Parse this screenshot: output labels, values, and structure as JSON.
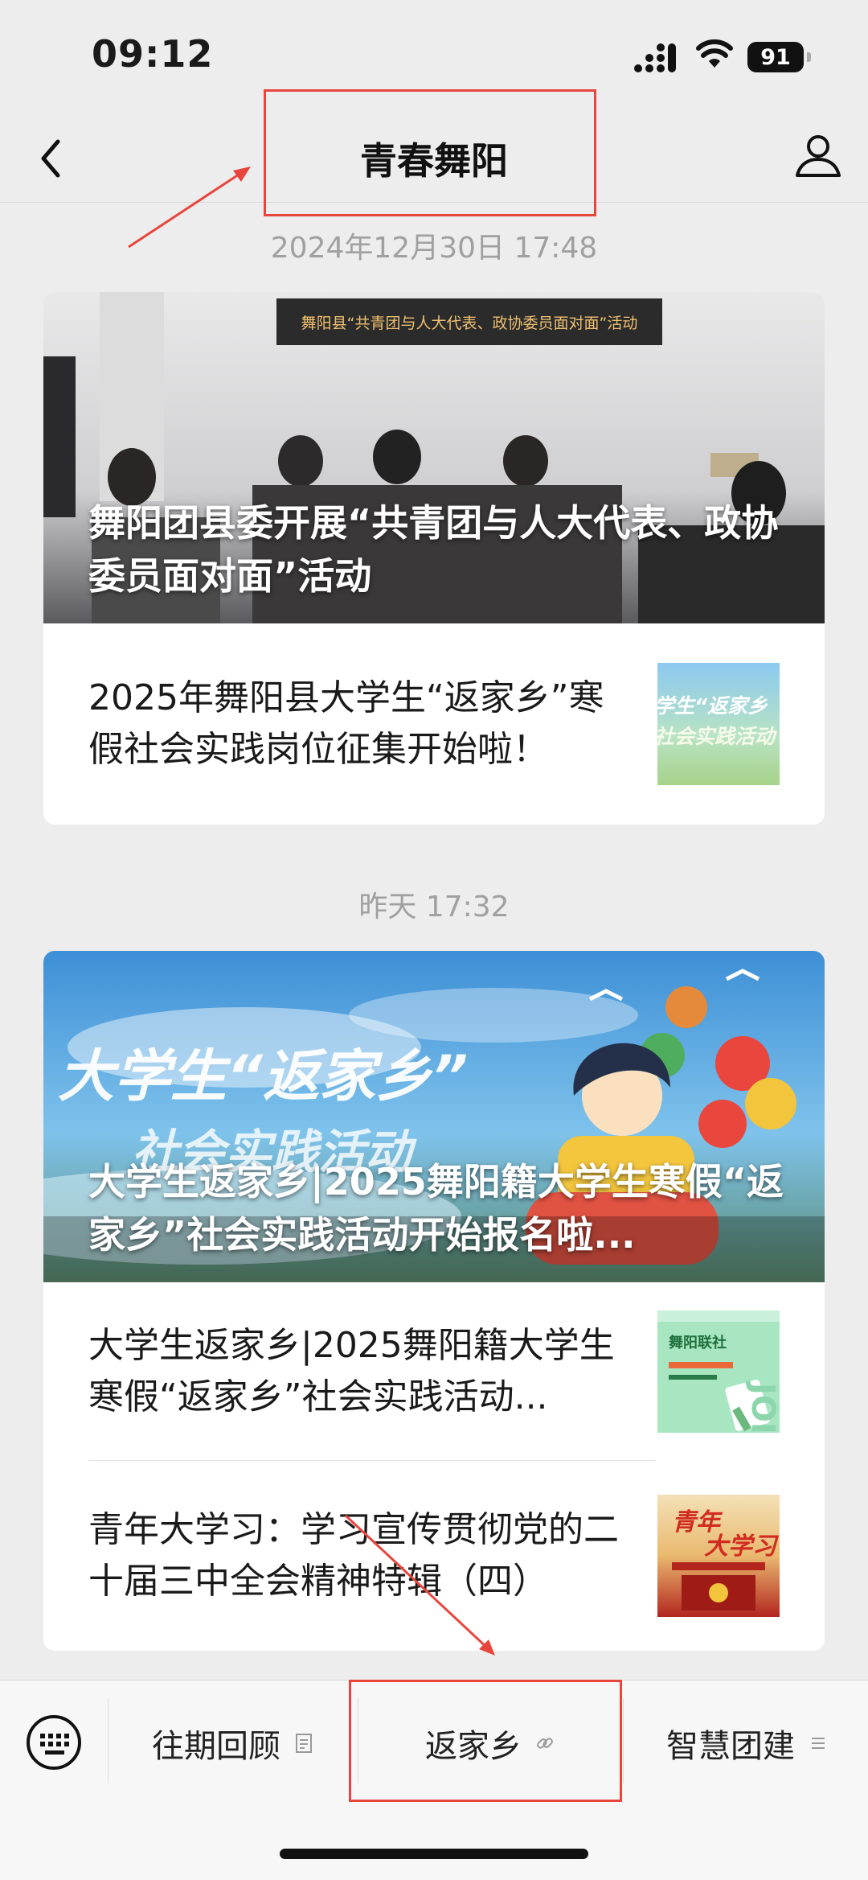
{
  "status_bar": {
    "time": "09:12",
    "battery": "91"
  },
  "nav": {
    "title": "青春舞阳"
  },
  "messages": [
    {
      "timestamp": "2024年12月30日 17:48",
      "hero": {
        "title": "舞阳团县委开展“共青团与人大代表、政协委员面对面”活动",
        "banner_text": "舞阳县“共青团与人大代表、政协委员面对面”活动"
      },
      "items": [
        {
          "title": "2025年舞阳县大学生“返家乡”寒假社会实践岗位征集开始啦！",
          "thumb_text": "学生“返家乡 社会实践活动"
        }
      ]
    },
    {
      "timestamp": "昨天 17:32",
      "hero": {
        "title": "大学生返家乡|2025舞阳籍大学生寒假“返家乡”社会实践活动开始报名啦...",
        "art_text": "大学生“返家乡” 社会实践活动"
      },
      "items": [
        {
          "title": "大学生返家乡|2025舞阳籍大学生寒假“返家乡”社会实践活动...",
          "thumb_text": "舞阳联社"
        },
        {
          "title": "青年大学习：学习宣传贯彻党的二十届三中全会精神特辑（四）",
          "thumb_text": "青年大学习"
        }
      ]
    }
  ],
  "bottom_menu": {
    "items": [
      {
        "label": "往期回顾",
        "icon": "document-icon"
      },
      {
        "label": "返家乡",
        "icon": "link-icon"
      },
      {
        "label": "智慧团建",
        "icon": "menu-lines-icon"
      }
    ]
  },
  "colors": {
    "annotation_red": "#e8453c",
    "background": "#ededed",
    "timestamp_gray": "#a0a0a0"
  }
}
